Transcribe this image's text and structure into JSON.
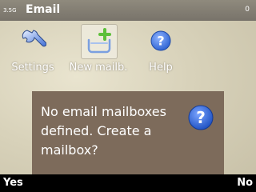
{
  "statusbar": {
    "signal_text": "3.5G",
    "title": "Email",
    "counter": "0"
  },
  "toolbar": {
    "items": [
      {
        "label": "Settings",
        "icon": "wrench-icon"
      },
      {
        "label": "New mailb.",
        "icon": "new-mailbox-icon"
      },
      {
        "label": "Help",
        "icon": "help-icon"
      }
    ]
  },
  "dialog": {
    "message": "No email mailboxes defined. Create a mailbox?",
    "icon": "question-icon"
  },
  "softkeys": {
    "left": "Yes",
    "right": "No"
  },
  "colors": {
    "dialog_bg": "#7d6b5b",
    "help_blue": "#2a5fd0",
    "plus_green": "#5cbf3a"
  }
}
